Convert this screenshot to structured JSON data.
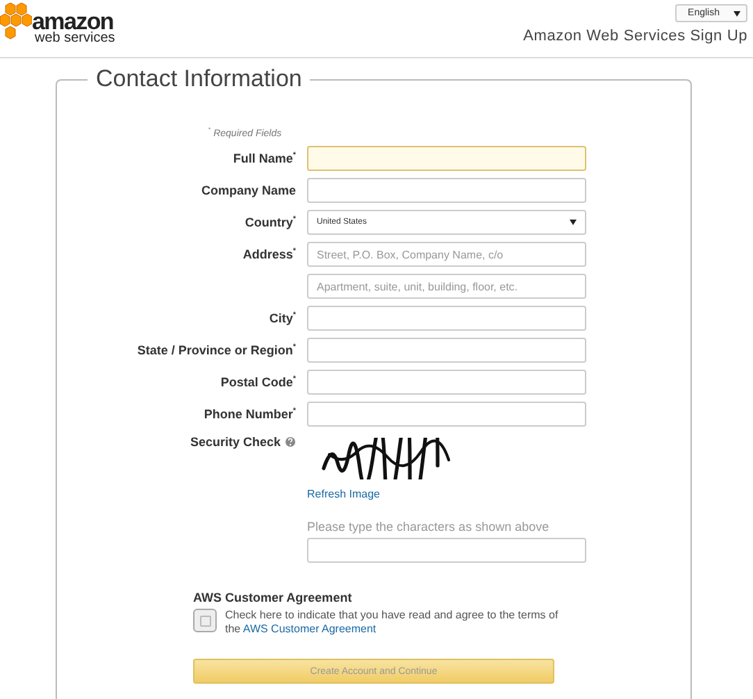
{
  "header": {
    "logo": [
      "amazon",
      "web services"
    ],
    "language": "English",
    "title": "Amazon Web Services Sign Up"
  },
  "form": {
    "legend": "Contact Information",
    "required_note": "$^{*}$ *Required Fields*",
    "rows": [
      {
        "kind": "text",
        "label": "Full Name$^{*}$",
        "focused": true
      },
      {
        "kind": "text",
        "label": "Company Name",
        "focused": false
      },
      {
        "kind": "select",
        "label": "Country$^{*}$",
        "value": "United States"
      },
      {
        "kind": "text",
        "label": "Address$^{*}$",
        "placeholder": "Street, P.O. Box, Company Name, c/o",
        "focused": false
      },
      {
        "kind": "text",
        "placeholder": "Apartment, suite, unit, building, floor, etc.",
        "focused": false
      },
      {
        "kind": "text",
        "label": "City$^{*}$",
        "focused": false
      },
      {
        "kind": "text",
        "label": "State / Province or Region$^{*}$",
        "focused": false
      },
      {
        "kind": "text",
        "label": "Postal Code$^{*}$",
        "focused": false
      },
      {
        "kind": "text",
        "label": "Phone Number$^{*}$",
        "focused": false
      }
    ],
    "security": {
      "label": "Security Check",
      "refresh": "Refresh Image",
      "prompt": "Please type the characters as shown above"
    },
    "agreement": {
      "heading": "AWS Customer Agreement",
      "checked": false,
      "text": "Check here to indicate that you have read and agree to the terms of the ",
      "link": "AWS Customer Agreement"
    },
    "submit": "Create Account and Continue"
  }
}
